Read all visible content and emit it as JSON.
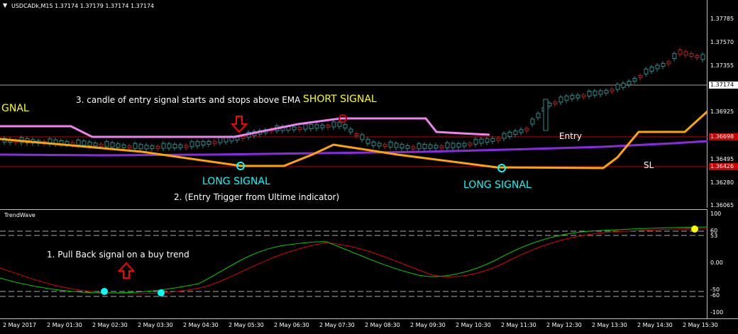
{
  "window": {
    "symbol_header": "USDCADk,M15  1.37174 1.37179 1.37174 1.37174",
    "menu_arrow_icon": "triangle-down-icon"
  },
  "price_axis": {
    "ticks": [
      "1.37785",
      "1.37570",
      "1.37355",
      "1.37174",
      "1.36925",
      "1.36698",
      "1.36495",
      "1.36426",
      "1.36280",
      "1.36065"
    ],
    "current_price": "1.37174",
    "entry_price": "1.36698",
    "sl_price": "1.36426"
  },
  "annotations": {
    "short_signal_left": "GNAL",
    "step3": "3. candle of entry signal starts and stops above EMA",
    "short_signal": "SHORT SIGNAL",
    "long_signal_1": "LONG SIGNAL",
    "step2": "2. (Entry Trigger from Ultime indicator)",
    "long_signal_2": "LONG SIGNAL",
    "entry": "Entry",
    "sl": "SL",
    "step1": "1. Pull Back signal on a buy trend"
  },
  "indicator": {
    "name": "TrendWave",
    "axis_ticks": [
      "100",
      "60",
      "53",
      "0.00",
      "-50",
      "-60",
      "-100"
    ]
  },
  "time_axis": {
    "ticks": [
      "2 May 2017",
      "2 May 01:30",
      "2 May 02:30",
      "2 May 03:30",
      "2 May 04:30",
      "2 May 05:30",
      "2 May 06:30",
      "2 May 07:30",
      "2 May 08:30",
      "2 May 09:30",
      "2 May 10:30",
      "2 May 11:30",
      "2 May 12:30",
      "2 May 13:30",
      "2 May 14:30",
      "2 May 15:30"
    ]
  },
  "colors": {
    "background": "#000000",
    "bull_candle": "#2e8b8b",
    "bear_candle": "#b22222",
    "ema_purple": "#8a2be2",
    "line_pink": "#ee82ee",
    "line_orange": "#ffa500",
    "signal_cyan": "#00ffff",
    "short_text": "#ffff00",
    "level_red": "#cc0000",
    "wave_green": "#00cc00",
    "wave_red": "#dd0000"
  }
}
